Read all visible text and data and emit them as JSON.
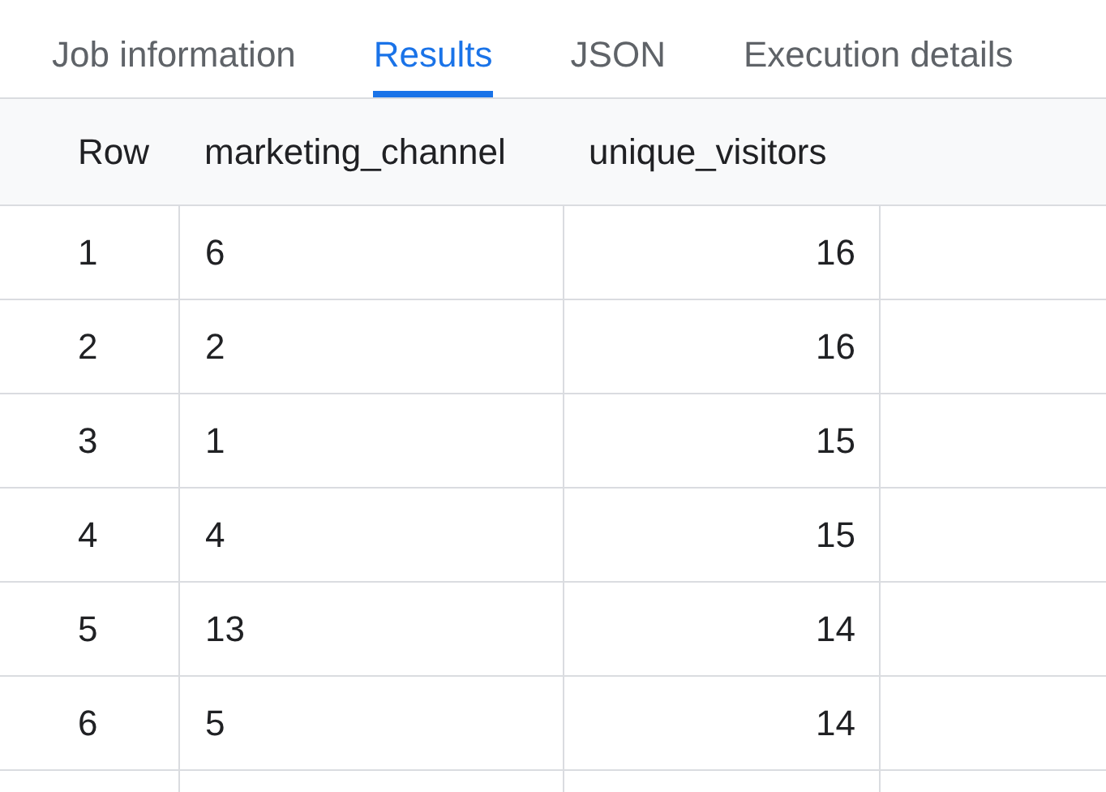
{
  "tabs": [
    {
      "label": "Job information",
      "selected": false
    },
    {
      "label": "Results",
      "selected": true
    },
    {
      "label": "JSON",
      "selected": false
    },
    {
      "label": "Execution details",
      "selected": false
    }
  ],
  "table": {
    "columns": [
      "Row",
      "marketing_channel",
      "unique_visitors"
    ],
    "rows": [
      [
        "1",
        "6",
        "16"
      ],
      [
        "2",
        "2",
        "16"
      ],
      [
        "3",
        "1",
        "15"
      ],
      [
        "4",
        "4",
        "15"
      ],
      [
        "5",
        "13",
        "14"
      ],
      [
        "6",
        "5",
        "14"
      ]
    ]
  }
}
